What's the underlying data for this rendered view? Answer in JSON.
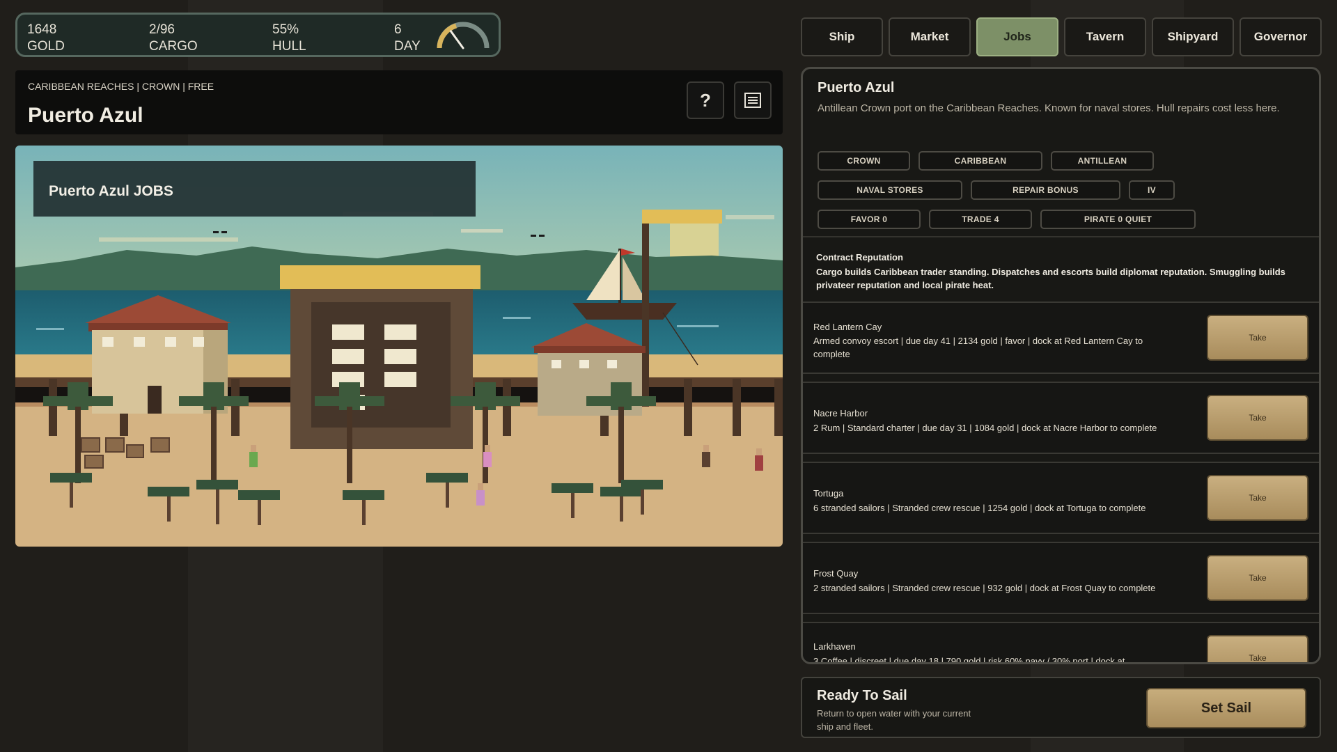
{
  "stats": [
    {
      "value": "1648",
      "label": "GOLD"
    },
    {
      "value": "2/96",
      "label": "CARGO"
    },
    {
      "value": "55%",
      "label": "HULL"
    },
    {
      "value": "6",
      "label": "DAY"
    }
  ],
  "gauge_fraction": 0.3,
  "location": {
    "tags": "CARIBBEAN REACHES | CROWN | FREE",
    "title": "Puerto Azul",
    "help_label": "?",
    "menu_icon": "list-icon"
  },
  "scene": {
    "title": "Puerto Azul JOBS"
  },
  "tabs": [
    {
      "label": "Ship",
      "active": false
    },
    {
      "label": "Market",
      "active": false
    },
    {
      "label": "Jobs",
      "active": true
    },
    {
      "label": "Tavern",
      "active": false
    },
    {
      "label": "Shipyard",
      "active": false
    },
    {
      "label": "Governor",
      "active": false
    }
  ],
  "port": {
    "name": "Puerto Azul",
    "description": "Antillean Crown port on the Caribbean Reaches. Known for naval stores. Hull repairs cost less here.",
    "chips": [
      "CROWN",
      "CARIBBEAN",
      "ANTILLEAN",
      "NAVAL STORES",
      "REPAIR BONUS",
      "IV",
      "FAVOR 0",
      "TRADE 4",
      "PIRATE 0 QUIET"
    ]
  },
  "reputation": {
    "title": "Contract Reputation",
    "text": "Cargo builds Caribbean trader standing. Dispatches and escorts build diplomat reputation. Smuggling builds privateer reputation and local pirate heat."
  },
  "jobs": [
    {
      "destination": "Red Lantern Cay",
      "description": "Armed convoy escort | due day 41 | 2134 gold | favor | dock at Red Lantern Cay to complete",
      "action": "Take"
    },
    {
      "destination": "Nacre Harbor",
      "description": "2 Rum | Standard charter | due day 31 | 1084 gold | dock at Nacre Harbor to complete",
      "action": "Take"
    },
    {
      "destination": "Tortuga",
      "description": "6 stranded sailors | Stranded crew rescue | 1254 gold | dock at Tortuga to complete",
      "action": "Take"
    },
    {
      "destination": "Frost Quay",
      "description": "2 stranded sailors | Stranded crew rescue | 932 gold | dock at Frost Quay to complete",
      "action": "Take"
    },
    {
      "destination": "Larkhaven",
      "description": "3 Coffee | discreet | due day 18 | 790 gold | risk 60% navy / 30% port | dock at",
      "action": "Take"
    }
  ],
  "sail": {
    "title": "Ready To Sail",
    "description": "Return to open water with your current ship and fleet.",
    "button": "Set Sail"
  },
  "colors": {
    "accent_active_tab": "#7d9067",
    "take_button": "#c9af80",
    "panel_bg": "#181815"
  }
}
